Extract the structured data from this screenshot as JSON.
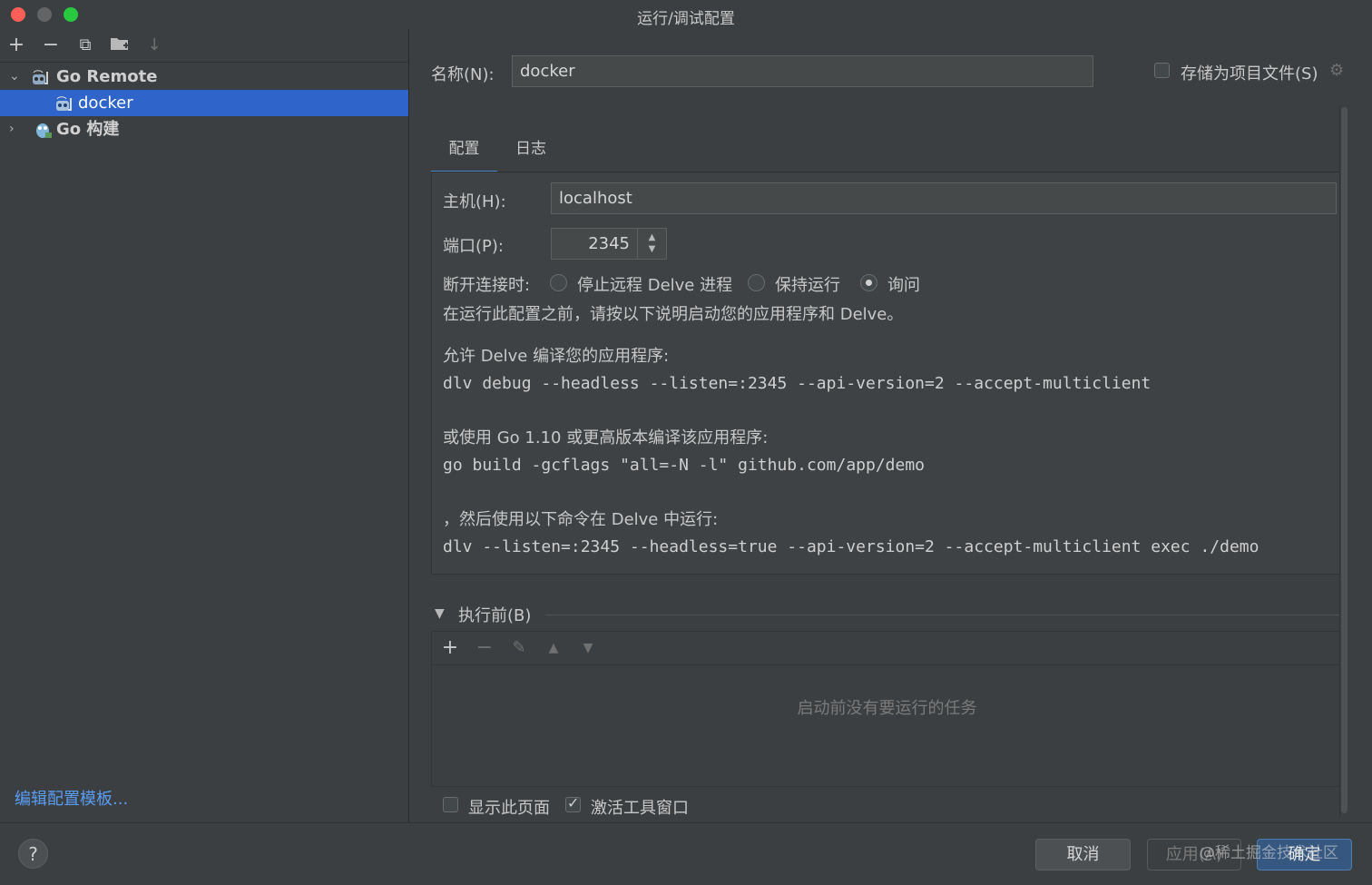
{
  "window": {
    "title": "运行/调试配置"
  },
  "sidebar": {
    "toolbar": {
      "add": "+",
      "remove": "−",
      "copy": "⧉",
      "folder": "▸",
      "sort": "↓"
    },
    "tree": [
      {
        "label": "Go Remote",
        "expanded": true,
        "level": 0
      },
      {
        "label": "docker",
        "selected": true,
        "level": 1
      },
      {
        "label": "Go 构建",
        "expanded": false,
        "level": 0
      }
    ],
    "edit_templates_link": "编辑配置模板..."
  },
  "form": {
    "name_label": "名称(N):",
    "name_value": "docker",
    "store_as_project_file_label": "存储为项目文件(S)",
    "store_as_project_file_checked": false,
    "tabs": [
      {
        "label": "配置",
        "active": true
      },
      {
        "label": "日志",
        "active": false
      }
    ],
    "host_label": "主机(H):",
    "host_value": "localhost",
    "port_label": "端口(P):",
    "port_value": "2345",
    "on_disconnect_label": "断开连接时:",
    "on_disconnect_options": [
      {
        "label": "停止远程 Delve 进程",
        "selected": false
      },
      {
        "label": "保持运行",
        "selected": false
      },
      {
        "label": "询问",
        "selected": true
      }
    ],
    "instructions_intro": "在运行此配置之前，请按以下说明启动您的应用程序和 Delve。",
    "allow_delve_label": "允许 Delve 编译您的应用程序:",
    "delve_debug_cmd": "dlv debug --headless --listen=:2345 --api-version=2 --accept-multiclient",
    "or_go_label": "或使用 Go 1.10 或更高版本编译该应用程序:",
    "go_build_cmd": "go build -gcflags \"all=-N -l\" github.com/app/demo",
    "then_label": "，然后使用以下命令在 Delve 中运行:",
    "dlv_exec_cmd": "dlv --listen=:2345 --headless=true --api-version=2 --accept-multiclient exec ./demo"
  },
  "before_launch": {
    "header": "执行前(B)",
    "empty_message": "启动前没有要运行的任务",
    "show_page_label": "显示此页面",
    "show_page_checked": false,
    "activate_tool_window_label": "激活工具窗口",
    "activate_tool_window_checked": true
  },
  "footer": {
    "help": "?",
    "cancel": "取消",
    "apply": "应用(A)",
    "ok": "确定",
    "watermark": "@稀土掘金技术社区"
  },
  "colors": {
    "selection": "#2f65ca",
    "link": "#589df6",
    "tab_underline": "#4a88c7",
    "ok_button": "#365880"
  }
}
